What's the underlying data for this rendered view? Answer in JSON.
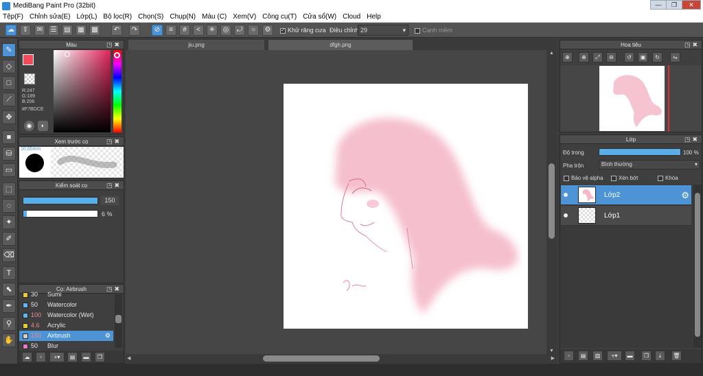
{
  "window": {
    "title": "MediBang Paint Pro (32bit)",
    "min": "—",
    "max": "❐",
    "close": "✕"
  },
  "menu": [
    "Tệp(F)",
    "Chỉnh sửa(E)",
    "Lớp(L)",
    "Bộ lọc(R)",
    "Chọn(S)",
    "Chụp(N)",
    "Màu (C)",
    "Xem(V)",
    "Công cụ(T)",
    "Cửa sổ(W)",
    "Cloud",
    "Help"
  ],
  "toolbar": {
    "antialias_label": "Khử răng cưa",
    "correction_label": "Điều chỉnh",
    "correction_value": "29",
    "edge_label": "Cạnh mềm"
  },
  "color_panel": {
    "title": "Màu",
    "r": "R:247",
    "g": "G:189",
    "b": "B:206",
    "hex": "#F7BDCE",
    "primary_color": "#f7bdce",
    "swatch_display": "#ef4d5a"
  },
  "brush_preview": {
    "title": "Xem trước cọ",
    "size": "10.00mm"
  },
  "brush_control": {
    "title": "Kiểm soát cọ",
    "size_value": "150",
    "opacity_value": "6 %"
  },
  "brush_list": {
    "title": "Cọ: Airbrush",
    "items": [
      {
        "size": "30",
        "name": "Sumi",
        "color": "#e8c93a"
      },
      {
        "size": "50",
        "name": "Watercolor",
        "color": "#5fb7ea"
      },
      {
        "size": "100",
        "name": "Watercolor (Wet)",
        "color": "#5fb7ea"
      },
      {
        "size": "4.6",
        "name": "Acrylic",
        "color": "#e8c93a"
      },
      {
        "size": "150",
        "name": "Airbrush",
        "color": "#cfcfcf"
      },
      {
        "size": "50",
        "name": "Blur",
        "color": "#e07ac9"
      }
    ]
  },
  "tabs": [
    "jiu.png",
    "dfgh.png"
  ],
  "navigator": {
    "title": "Hoa tiêu"
  },
  "layers": {
    "title": "Lớp",
    "opacity_label": "Độ trong",
    "opacity_value": "100 %",
    "opacity_fraction": 1.0,
    "blend_label": "Pha trộn",
    "blend_value": "Bình thường",
    "protect_alpha": "Bảo vệ alpha",
    "clipping": "Xén bớt",
    "lock": "Khóa",
    "items": [
      {
        "name": "Lớp2",
        "selected": true
      },
      {
        "name": "Lớp1",
        "selected": false
      }
    ]
  },
  "drawing": {
    "hair_color": "#f4b8c8",
    "line_color": "#d97a94"
  }
}
